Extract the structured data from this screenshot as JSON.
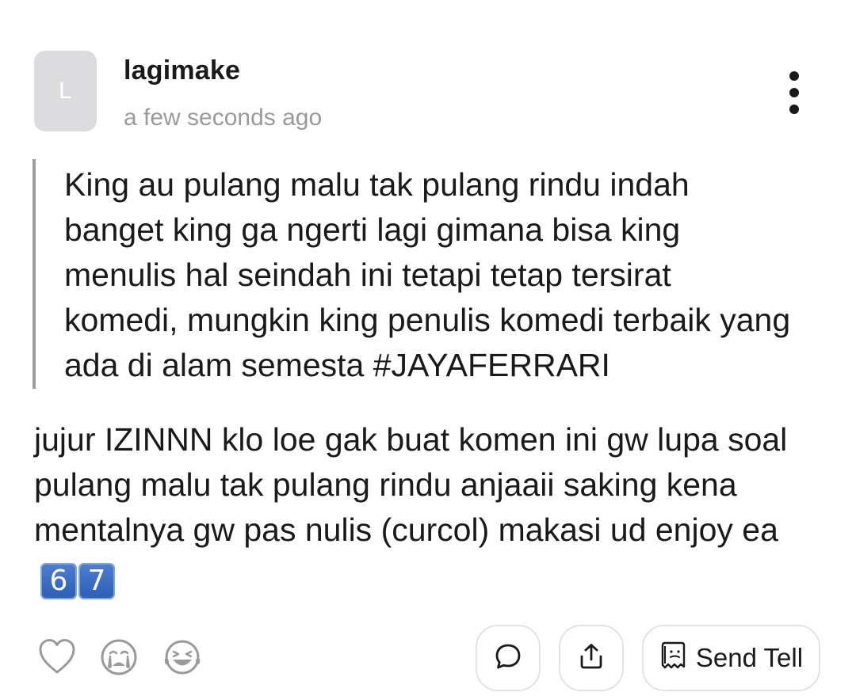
{
  "comment": {
    "avatar_initial": "L",
    "username": "lagimake",
    "timestamp": "a few seconds ago",
    "quoted_text": "King au pulang malu tak pulang rindu indah banget king ga ngerti lagi gimana bisa king menulis hal seindah ini tetapi tetap tersirat komedi, mungkin king penulis komedi terbaik yang ada di alam semesta #JAYAFERRARI",
    "reply_text": "jujur IZINNN klo loe gak buat komen ini gw lupa soal pulang malu tak pulang rindu anjaaii saking kena mentalnya gw pas nulis (curcol) makasi ud enjoy ea",
    "reply_emoji": [
      "6",
      "7"
    ]
  },
  "actions": {
    "reactions": [
      {
        "name": "heart-icon"
      },
      {
        "name": "crying-face-icon"
      },
      {
        "name": "laughing-face-icon"
      }
    ],
    "comment_icon": "speech-bubble-icon",
    "share_icon": "share-upload-icon",
    "send_tell_icon": "scroll-paper-icon",
    "send_tell_label": "Send Tell"
  },
  "colors": {
    "accent_text": "#1a1a1a",
    "muted_text": "#9a9a9a",
    "avatar_bg": "#dcdcde",
    "quote_bar": "#9c9c9c",
    "emoji_keycap": "#2c5db8"
  }
}
